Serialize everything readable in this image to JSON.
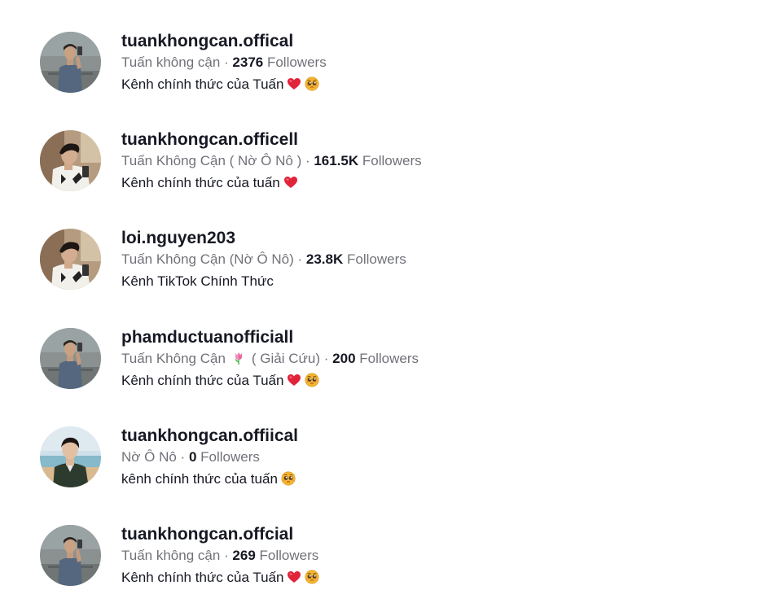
{
  "results": [
    {
      "username": "tuankhongcan.offical",
      "nickname": "Tuấn không cận",
      "separator": " · ",
      "followers": "2376",
      "followers_label": " Followers",
      "bio": "Kênh chính thức của Tuấn",
      "bio_emojis": [
        "red-heart-emoji",
        "pleading-face-emoji"
      ],
      "avatar": "avatar-man-selfie-gray"
    },
    {
      "username": "tuankhongcan.officell",
      "nickname": "Tuấn Không Cận ( Nờ Ô Nô )",
      "separator": " · ",
      "followers": "161.5K",
      "followers_label": " Followers",
      "bio": "Kênh chính thức của tuấn",
      "bio_emojis": [
        "red-heart-emoji"
      ],
      "avatar": "avatar-man-white-sweater"
    },
    {
      "username": "loi.nguyen203",
      "nickname": "Tuấn Không Cận (Nờ Ô Nô)",
      "separator": " · ",
      "followers": "23.8K",
      "followers_label": " Followers",
      "bio": "Kênh TikTok Chính Thức",
      "bio_emojis": [],
      "avatar": "avatar-man-white-sweater"
    },
    {
      "username": "phamductuanofficiall",
      "nickname_before": "Tuấn Không Cận",
      "nickname_emoji": "tulip-emoji",
      "nickname_after": "( Giải Cứu)",
      "separator": " · ",
      "followers": "200",
      "followers_label": " Followers",
      "bio": "Kênh chính thức của Tuấn",
      "bio_emojis": [
        "red-heart-emoji",
        "pleading-face-emoji"
      ],
      "avatar": "avatar-man-selfie-gray"
    },
    {
      "username": "tuankhongcan.offiical",
      "nickname": "Nờ Ô Nô",
      "separator": " · ",
      "followers": "0",
      "followers_label": " Followers",
      "bio": "kênh chính thức của tuấn",
      "bio_emojis": [
        "pleading-face-emoji"
      ],
      "avatar": "avatar-man-beach"
    },
    {
      "username": "tuankhongcan.offcial",
      "nickname": "Tuấn không cận",
      "separator": " · ",
      "followers": "269",
      "followers_label": " Followers",
      "bio": "Kênh chính thức của Tuấn",
      "bio_emojis": [
        "red-heart-emoji",
        "pleading-face-emoji"
      ],
      "avatar": "avatar-man-selfie-gray"
    }
  ],
  "colors": {
    "text_primary": "#161823",
    "text_secondary": "rgba(22,24,35,0.62)",
    "heart": "#e0243a",
    "emoji_face": "#f5b52e"
  }
}
